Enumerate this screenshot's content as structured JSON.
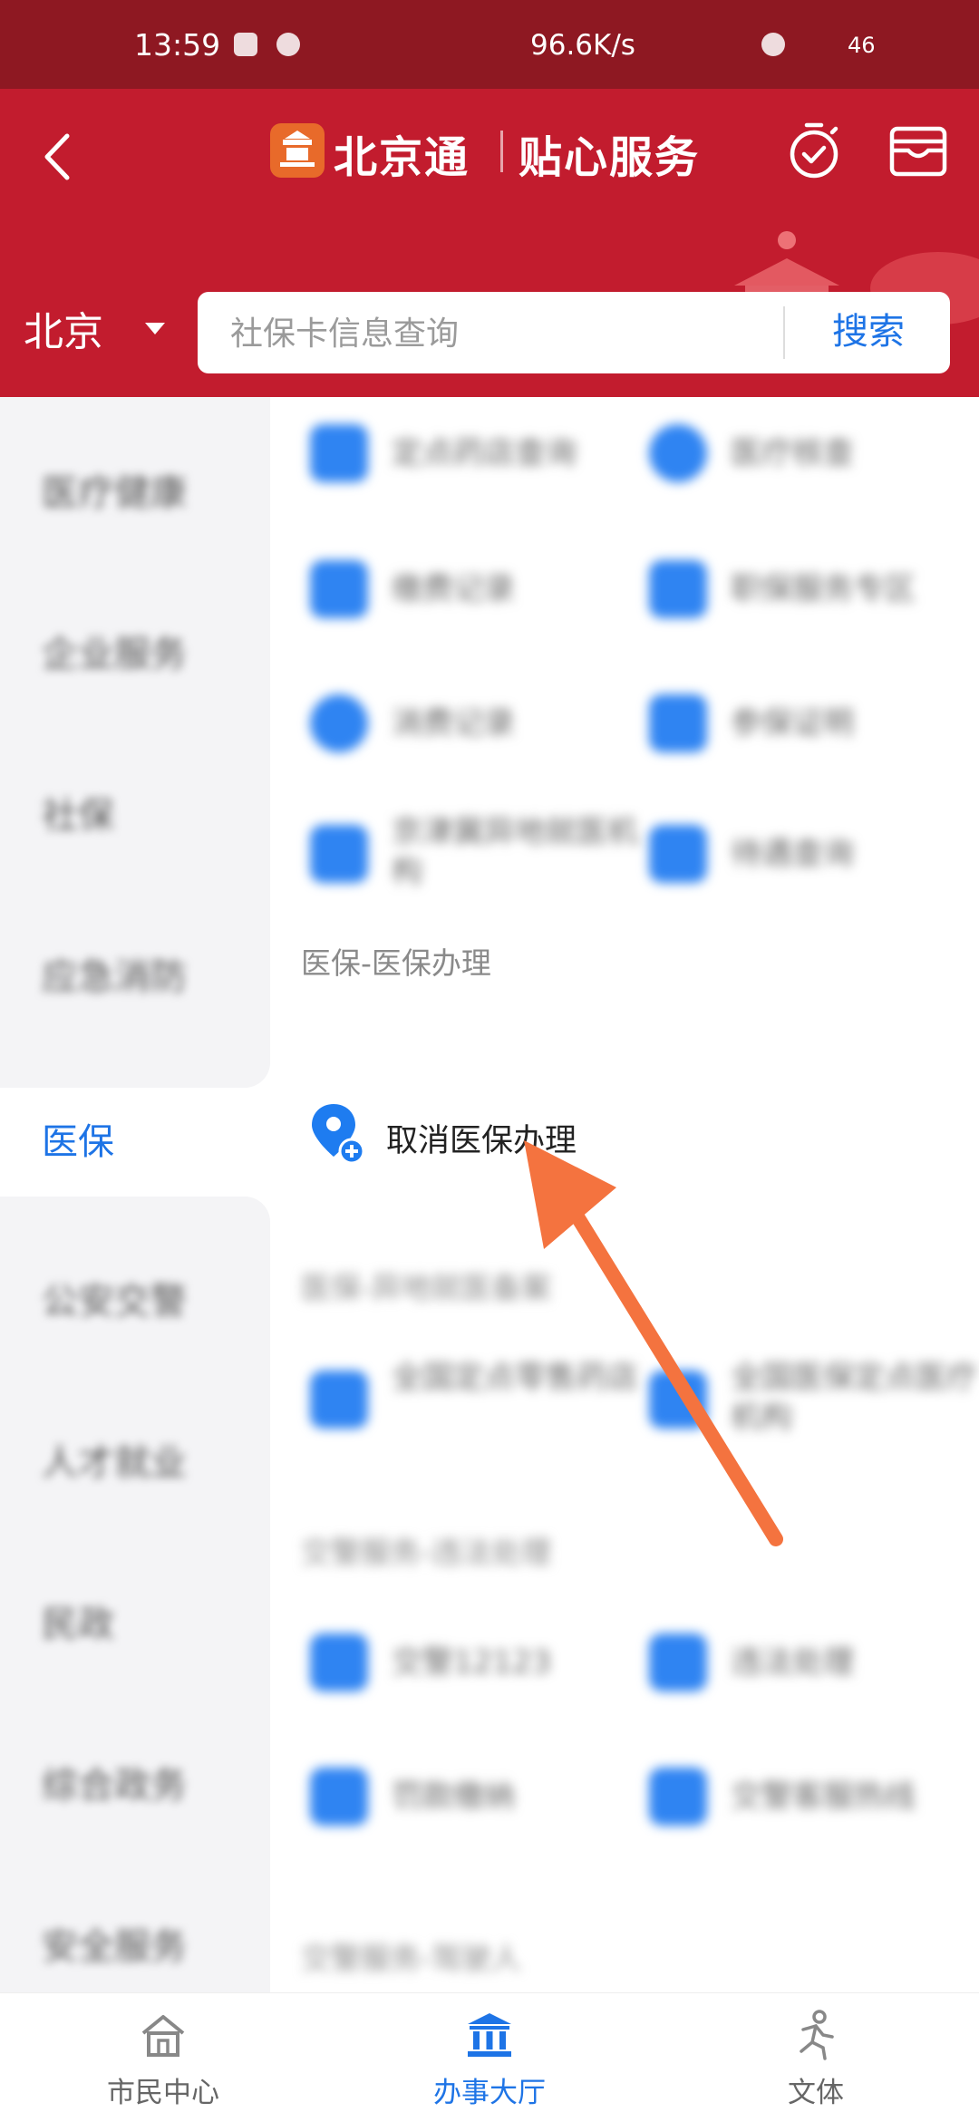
{
  "status_bar": {
    "time": "13:59",
    "network_speed": "96.6K/s",
    "signal": "46"
  },
  "header": {
    "brand": "北京通",
    "brand_sub": "贴心服务",
    "city": "北京",
    "search_placeholder": "社保卡信息查询",
    "search_button": "搜索",
    "colors": {
      "header_bg": "#c21c2e",
      "status_bg": "#8e1822",
      "accent": "#1e74e6"
    }
  },
  "sidebar": {
    "active": "医保",
    "items": [
      "医疗健康",
      "企业服务",
      "社保",
      "应急消防",
      "医保",
      "公安交警",
      "人才就业",
      "民政",
      "综合政务",
      "安全服务"
    ]
  },
  "section": {
    "title": "医保-医保办理",
    "item_label": "取消医保办理"
  },
  "tabbar": {
    "tabs": [
      {
        "label": "市民中心",
        "active": false
      },
      {
        "label": "办事大厅",
        "active": true
      },
      {
        "label": "文体",
        "active": false
      }
    ]
  }
}
